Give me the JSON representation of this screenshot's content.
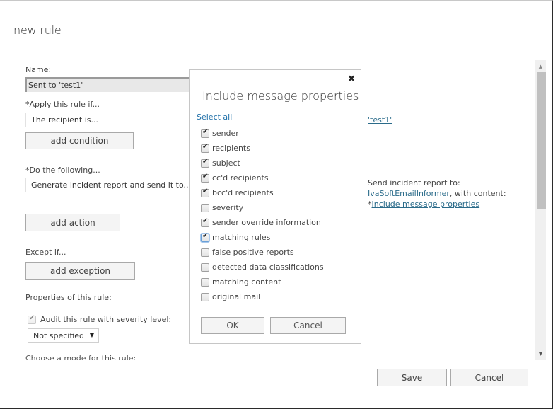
{
  "window": {
    "title": "new rule"
  },
  "form": {
    "name_label": "Name:",
    "name_value": "Sent to 'test1'",
    "apply_label": "*Apply this rule if...",
    "apply_value": "The recipient is...",
    "add_condition": "add condition",
    "do_label": "*Do the following...",
    "do_value": "Generate incident report and send it to...",
    "add_action": "add action",
    "except_label": "Except if...",
    "add_exception": "add exception",
    "properties_label": "Properties of this rule:",
    "audit_label": "Audit this rule with severity level:",
    "audit_checked": true,
    "severity_value": "Not specified",
    "mode_label": "Choose a mode for this rule:"
  },
  "right_panel": {
    "condition_link": "'test1'",
    "report_line1": "Send incident report to:",
    "report_recipient": "IvaSoftEmailInformer",
    "report_with": ", with content:",
    "report_prefix": "*",
    "report_content_link": "Include message properties"
  },
  "modal": {
    "title": "Include message properties",
    "close_icon": "close-icon",
    "select_all": "Select all",
    "options": [
      {
        "label": "sender",
        "checked": true
      },
      {
        "label": "recipients",
        "checked": true
      },
      {
        "label": "subject",
        "checked": true
      },
      {
        "label": "cc'd recipients",
        "checked": true
      },
      {
        "label": "bcc'd recipients",
        "checked": true
      },
      {
        "label": "severity",
        "checked": false
      },
      {
        "label": "sender override information",
        "checked": true
      },
      {
        "label": "matching rules",
        "checked": true,
        "focused": true
      },
      {
        "label": "false positive reports",
        "checked": false
      },
      {
        "label": "detected data classifications",
        "checked": false
      },
      {
        "label": "matching content",
        "checked": false
      },
      {
        "label": "original mail",
        "checked": false
      }
    ],
    "ok": "OK",
    "cancel": "Cancel"
  },
  "footer": {
    "save": "Save",
    "cancel": "Cancel"
  }
}
